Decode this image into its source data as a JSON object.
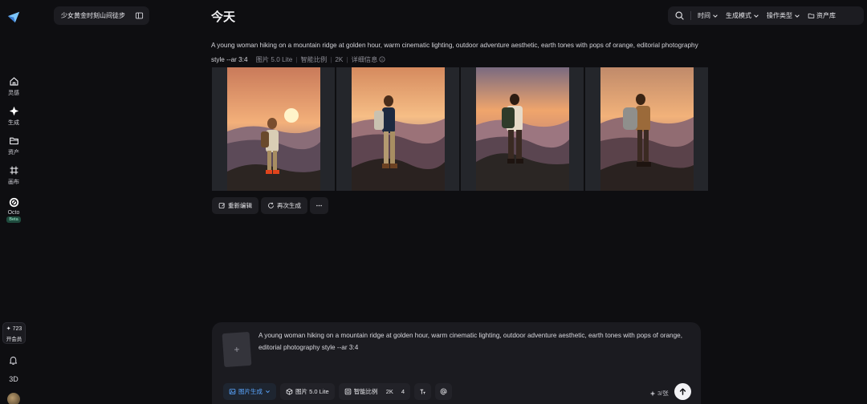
{
  "sidebar": {
    "items": [
      {
        "label": "灵感",
        "icon": "home-icon"
      },
      {
        "label": "生成",
        "icon": "sparkle-icon"
      },
      {
        "label": "资产",
        "icon": "folder-icon"
      },
      {
        "label": "画布",
        "icon": "canvas-icon"
      },
      {
        "label": "Octo",
        "icon": "octo-icon",
        "badge": "Beta"
      }
    ],
    "credits": "723",
    "vip_label": "开会员",
    "three_d": "3D"
  },
  "session": {
    "title": "少女黄金时刻山间徒步"
  },
  "page": {
    "title": "今天"
  },
  "toolbar": {
    "time": "时间",
    "mode": "生成模式",
    "op_type": "操作类型",
    "assets": "资产库"
  },
  "result": {
    "prompt": "A young woman hiking on a mountain ridge at golden hour, warm cinematic lighting, outdoor adventure aesthetic, earth tones with pops of orange, editorial photography style --ar 3:4",
    "model": "图片 5.0 Lite",
    "ratio": "智能比例",
    "resolution": "2K",
    "details": "详细信息"
  },
  "actions": {
    "reedit": "重新编辑",
    "regenerate": "再次生成"
  },
  "composer": {
    "prompt": "A young woman hiking on a mountain ridge at golden hour, warm cinematic lighting, outdoor adventure aesthetic, earth tones with pops of orange, editorial photography style --ar 3:4",
    "mode": "图片生成",
    "model": "图片 5.0 Lite",
    "ratio": "智能比例",
    "resolution": "2K",
    "count": "4",
    "cost": "3/张"
  },
  "colors": {
    "accent": "#5aa6ff",
    "background": "#0e0e11",
    "panel": "#1b1b20"
  }
}
